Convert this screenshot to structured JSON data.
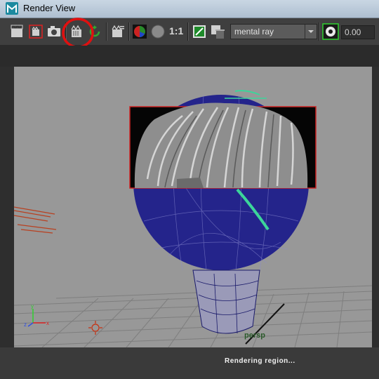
{
  "window": {
    "title": "Render View"
  },
  "toolbar": {
    "buttons": [
      {
        "name": "render-frame-icon"
      },
      {
        "name": "render-region-icon"
      },
      {
        "name": "snapshot-icon"
      },
      {
        "name": "ipr-render-icon"
      },
      {
        "name": "refresh-ipr-icon"
      },
      {
        "name": "render-settings-icon"
      },
      {
        "name": "rgb-channels-icon"
      },
      {
        "name": "alpha-channel-icon"
      },
      {
        "name": "keep-image-icon"
      },
      {
        "name": "remove-image-icon"
      },
      {
        "name": "exposure-icon"
      }
    ],
    "ratio_label": "1:1",
    "renderer": "mental ray",
    "exposure_value": "0.00"
  },
  "viewport": {
    "camera_label": "persp"
  },
  "status": {
    "text": "Rendering region..."
  },
  "colors": {
    "highlight_circle": "#e01010",
    "region_border": "#cc2222",
    "wireframe": "#1a1a8a",
    "guide_green": "#3cd59a"
  }
}
